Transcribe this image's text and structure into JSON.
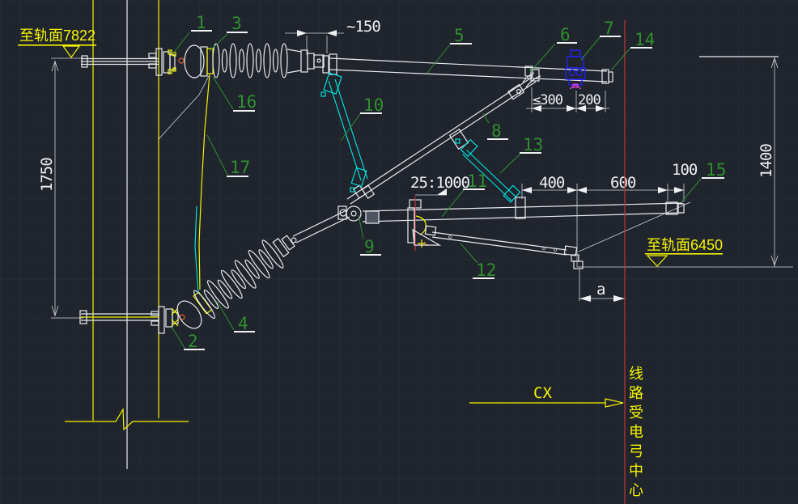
{
  "colors": {
    "background": "#20242c",
    "grid": "#2a3140",
    "structure_white": "#e9ebee",
    "highlight_yellow": "#f5f500",
    "highlight_cyan": "#00dede",
    "label_green": "#2f8f2f",
    "clamp_blue": "#2222ee",
    "centerline_red": "#c03636"
  },
  "datums": {
    "top_rail_level": "至轨面7822",
    "bottom_rail_level": "至轨面6450"
  },
  "part_labels": {
    "p1": "1",
    "p2": "2",
    "p3": "3",
    "p4": "4",
    "p5": "5",
    "p6": "6",
    "p7": "7",
    "p8": "8",
    "p9": "9",
    "p10": "10",
    "p11": "11",
    "p12": "12",
    "p13": "13",
    "p14": "14",
    "p15": "15",
    "p16": "16",
    "p17": "17"
  },
  "dimensions": {
    "d150": "~150",
    "d300": "≤300",
    "d200": "200",
    "d400": "400",
    "d600": "600",
    "d100": "100",
    "d1400": "1400",
    "d1750": "1750",
    "da": "a",
    "slope": "25:1000"
  },
  "annotations": {
    "cx": "CX",
    "pantograph_center": "线路受电弓中心"
  }
}
